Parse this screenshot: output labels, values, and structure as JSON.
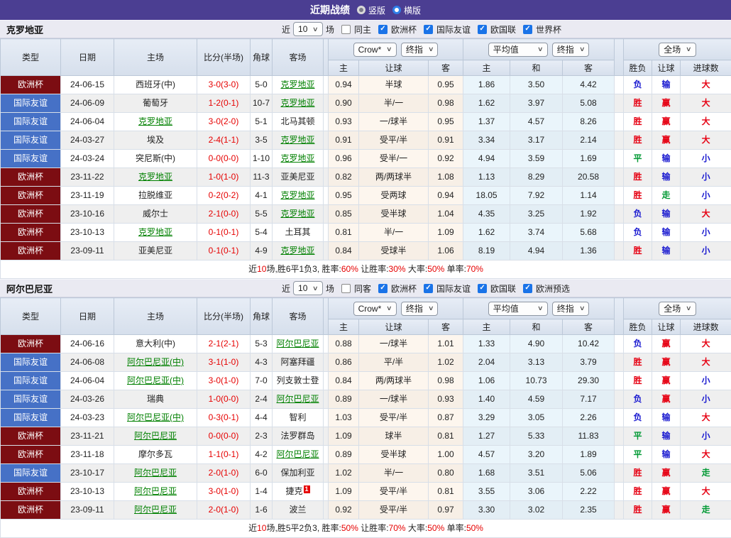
{
  "icons": {
    "check": "✓",
    "select_arrow": "∨"
  },
  "title_bar": {
    "title": "近期战绩",
    "radios": [
      {
        "label": "竖版",
        "selected": true
      },
      {
        "label": "横版",
        "selected": false
      }
    ]
  },
  "table_header": {
    "cols": [
      "类型",
      "日期",
      "主场",
      "比分(半场)",
      "角球",
      "客场"
    ],
    "odds_group": {
      "company": "Crow*",
      "stage": "终指",
      "sub": [
        "主",
        "让球",
        "客"
      ]
    },
    "avg_group": {
      "company": "平均值",
      "stage": "终指",
      "sub": [
        "主",
        "和",
        "客"
      ]
    },
    "result_group": {
      "scope": "全场",
      "sub": [
        "胜负",
        "让球",
        "进球数"
      ]
    }
  },
  "type_colors": {
    "欧洲杯": "t-maroon",
    "国际友谊": "t-blue"
  },
  "result_colors": {
    "胜": "r-red",
    "负": "r-blue",
    "平": "r-green",
    "赢": "r-red",
    "输": "r-blue",
    "走": "r-green",
    "大": "r-red",
    "小": "r-blue"
  },
  "sections": [
    {
      "team": "克罗地亚",
      "filter": {
        "near_label": "近",
        "count": "10",
        "games_label": "场",
        "same_label": "同主",
        "same_checked": false,
        "competitions": [
          "欧洲杯",
          "国际友谊",
          "欧国联",
          "世界杯"
        ]
      },
      "rows": [
        {
          "type": "欧洲杯",
          "date": "24-06-15",
          "home": "西班牙(中)",
          "home_link": false,
          "score": "3-0(3-0)",
          "corner": "5-0",
          "away": "克罗地亚",
          "away_link": true,
          "odds": [
            "0.94",
            "半球",
            "0.95"
          ],
          "avg": [
            "1.86",
            "3.50",
            "4.42"
          ],
          "res": [
            "负",
            "输",
            "大"
          ]
        },
        {
          "type": "国际友谊",
          "date": "24-06-09",
          "home": "葡萄牙",
          "home_link": false,
          "score": "1-2(0-1)",
          "corner": "10-7",
          "away": "克罗地亚",
          "away_link": true,
          "odds": [
            "0.90",
            "半/一",
            "0.98"
          ],
          "avg": [
            "1.62",
            "3.97",
            "5.08"
          ],
          "res": [
            "胜",
            "赢",
            "大"
          ]
        },
        {
          "type": "国际友谊",
          "date": "24-06-04",
          "home": "克罗地亚",
          "home_link": true,
          "score": "3-0(2-0)",
          "corner": "5-1",
          "away": "北马其顿",
          "away_link": false,
          "odds": [
            "0.93",
            "一/球半",
            "0.95"
          ],
          "avg": [
            "1.37",
            "4.57",
            "8.26"
          ],
          "res": [
            "胜",
            "赢",
            "大"
          ]
        },
        {
          "type": "国际友谊",
          "date": "24-03-27",
          "home": "埃及",
          "home_link": false,
          "score": "2-4(1-1)",
          "corner": "3-5",
          "away": "克罗地亚",
          "away_link": true,
          "odds": [
            "0.91",
            "受平/半",
            "0.91"
          ],
          "avg": [
            "3.34",
            "3.17",
            "2.14"
          ],
          "res": [
            "胜",
            "赢",
            "大"
          ]
        },
        {
          "type": "国际友谊",
          "date": "24-03-24",
          "home": "突尼斯(中)",
          "home_link": false,
          "score": "0-0(0-0)",
          "corner": "1-10",
          "away": "克罗地亚",
          "away_link": true,
          "odds": [
            "0.96",
            "受半/一",
            "0.92"
          ],
          "avg": [
            "4.94",
            "3.59",
            "1.69"
          ],
          "res": [
            "平",
            "输",
            "小"
          ]
        },
        {
          "type": "欧洲杯",
          "date": "23-11-22",
          "home": "克罗地亚",
          "home_link": true,
          "score": "1-0(1-0)",
          "corner": "11-3",
          "away": "亚美尼亚",
          "away_link": false,
          "odds": [
            "0.82",
            "两/两球半",
            "1.08"
          ],
          "avg": [
            "1.13",
            "8.29",
            "20.58"
          ],
          "res": [
            "胜",
            "输",
            "小"
          ]
        },
        {
          "type": "欧洲杯",
          "date": "23-11-19",
          "home": "拉脱维亚",
          "home_link": false,
          "score": "0-2(0-2)",
          "corner": "4-1",
          "away": "克罗地亚",
          "away_link": true,
          "odds": [
            "0.95",
            "受两球",
            "0.94"
          ],
          "avg": [
            "18.05",
            "7.92",
            "1.14"
          ],
          "res": [
            "胜",
            "走",
            "小"
          ]
        },
        {
          "type": "欧洲杯",
          "date": "23-10-16",
          "home": "威尔士",
          "home_link": false,
          "score": "2-1(0-0)",
          "corner": "5-5",
          "away": "克罗地亚",
          "away_link": true,
          "odds": [
            "0.85",
            "受半球",
            "1.04"
          ],
          "avg": [
            "4.35",
            "3.25",
            "1.92"
          ],
          "res": [
            "负",
            "输",
            "大"
          ]
        },
        {
          "type": "欧洲杯",
          "date": "23-10-13",
          "home": "克罗地亚",
          "home_link": true,
          "score": "0-1(0-1)",
          "corner": "5-4",
          "away": "土耳其",
          "away_link": false,
          "odds": [
            "0.81",
            "半/一",
            "1.09"
          ],
          "avg": [
            "1.62",
            "3.74",
            "5.68"
          ],
          "res": [
            "负",
            "输",
            "小"
          ]
        },
        {
          "type": "欧洲杯",
          "date": "23-09-11",
          "home": "亚美尼亚",
          "home_link": false,
          "score": "0-1(0-1)",
          "corner": "4-9",
          "away": "克罗地亚",
          "away_link": true,
          "odds": [
            "0.84",
            "受球半",
            "1.06"
          ],
          "avg": [
            "8.19",
            "4.94",
            "1.36"
          ],
          "res": [
            "胜",
            "输",
            "小"
          ]
        }
      ],
      "summary": [
        {
          "text": "近"
        },
        {
          "text": "10",
          "red": true
        },
        {
          "text": "场,胜6平1负3, 胜率:"
        },
        {
          "text": "60%",
          "red": true
        },
        {
          "text": " 让胜率:"
        },
        {
          "text": "30%",
          "red": true
        },
        {
          "text": " 大率:"
        },
        {
          "text": "50%",
          "red": true
        },
        {
          "text": " 单率:"
        },
        {
          "text": "70%",
          "red": true
        }
      ]
    },
    {
      "team": "阿尔巴尼亚",
      "filter": {
        "near_label": "近",
        "count": "10",
        "games_label": "场",
        "same_label": "同客",
        "same_checked": false,
        "competitions": [
          "欧洲杯",
          "国际友谊",
          "欧国联",
          "欧洲预选"
        ]
      },
      "rows": [
        {
          "type": "欧洲杯",
          "date": "24-06-16",
          "home": "意大利(中)",
          "home_link": false,
          "score": "2-1(2-1)",
          "corner": "5-3",
          "away": "阿尔巴尼亚",
          "away_link": true,
          "odds": [
            "0.88",
            "一/球半",
            "1.01"
          ],
          "avg": [
            "1.33",
            "4.90",
            "10.42"
          ],
          "res": [
            "负",
            "赢",
            "大"
          ]
        },
        {
          "type": "国际友谊",
          "date": "24-06-08",
          "home": "阿尔巴尼亚(中)",
          "home_link": true,
          "score": "3-1(1-0)",
          "corner": "4-3",
          "away": "阿塞拜疆",
          "away_link": false,
          "odds": [
            "0.86",
            "平/半",
            "1.02"
          ],
          "avg": [
            "2.04",
            "3.13",
            "3.79"
          ],
          "res": [
            "胜",
            "赢",
            "大"
          ]
        },
        {
          "type": "国际友谊",
          "date": "24-06-04",
          "home": "阿尔巴尼亚(中)",
          "home_link": true,
          "score": "3-0(1-0)",
          "corner": "7-0",
          "away": "列支敦士登",
          "away_link": false,
          "odds": [
            "0.84",
            "两/两球半",
            "0.98"
          ],
          "avg": [
            "1.06",
            "10.73",
            "29.30"
          ],
          "res": [
            "胜",
            "赢",
            "小"
          ]
        },
        {
          "type": "国际友谊",
          "date": "24-03-26",
          "home": "瑞典",
          "home_link": false,
          "score": "1-0(0-0)",
          "corner": "2-4",
          "away": "阿尔巴尼亚",
          "away_link": true,
          "odds": [
            "0.89",
            "一/球半",
            "0.93"
          ],
          "avg": [
            "1.40",
            "4.59",
            "7.17"
          ],
          "res": [
            "负",
            "赢",
            "小"
          ]
        },
        {
          "type": "国际友谊",
          "date": "24-03-23",
          "home": "阿尔巴尼亚(中)",
          "home_link": true,
          "score": "0-3(0-1)",
          "corner": "4-4",
          "away": "智利",
          "away_link": false,
          "odds": [
            "1.03",
            "受平/半",
            "0.87"
          ],
          "avg": [
            "3.29",
            "3.05",
            "2.26"
          ],
          "res": [
            "负",
            "输",
            "大"
          ]
        },
        {
          "type": "欧洲杯",
          "date": "23-11-21",
          "home": "阿尔巴尼亚",
          "home_link": true,
          "score": "0-0(0-0)",
          "corner": "2-3",
          "away": "法罗群岛",
          "away_link": false,
          "odds": [
            "1.09",
            "球半",
            "0.81"
          ],
          "avg": [
            "1.27",
            "5.33",
            "11.83"
          ],
          "res": [
            "平",
            "输",
            "小"
          ]
        },
        {
          "type": "欧洲杯",
          "date": "23-11-18",
          "home": "摩尔多瓦",
          "home_link": false,
          "score": "1-1(0-1)",
          "corner": "4-2",
          "away": "阿尔巴尼亚",
          "away_link": true,
          "odds": [
            "0.89",
            "受半球",
            "1.00"
          ],
          "avg": [
            "4.57",
            "3.20",
            "1.89"
          ],
          "res": [
            "平",
            "输",
            "大"
          ]
        },
        {
          "type": "国际友谊",
          "date": "23-10-17",
          "home": "阿尔巴尼亚",
          "home_link": true,
          "score": "2-0(1-0)",
          "corner": "6-0",
          "away": "保加利亚",
          "away_link": false,
          "odds": [
            "1.02",
            "半/一",
            "0.80"
          ],
          "avg": [
            "1.68",
            "3.51",
            "5.06"
          ],
          "res": [
            "胜",
            "赢",
            "走"
          ]
        },
        {
          "type": "欧洲杯",
          "date": "23-10-13",
          "home": "阿尔巴尼亚",
          "home_link": true,
          "score": "3-0(1-0)",
          "corner": "1-4",
          "away": "捷克",
          "away_link": false,
          "away_sup": "1",
          "odds": [
            "1.09",
            "受平/半",
            "0.81"
          ],
          "avg": [
            "3.55",
            "3.06",
            "2.22"
          ],
          "res": [
            "胜",
            "赢",
            "大"
          ]
        },
        {
          "type": "欧洲杯",
          "date": "23-09-11",
          "home": "阿尔巴尼亚",
          "home_link": true,
          "score": "2-0(1-0)",
          "corner": "1-6",
          "away": "波兰",
          "away_link": false,
          "odds": [
            "0.92",
            "受平/半",
            "0.97"
          ],
          "avg": [
            "3.30",
            "3.02",
            "2.35"
          ],
          "res": [
            "胜",
            "赢",
            "走"
          ]
        }
      ],
      "summary": [
        {
          "text": "近"
        },
        {
          "text": "10",
          "red": true
        },
        {
          "text": "场,胜5平2负3, 胜率:"
        },
        {
          "text": "50%",
          "red": true
        },
        {
          "text": " 让胜率:"
        },
        {
          "text": "70%",
          "red": true
        },
        {
          "text": " 大率:"
        },
        {
          "text": "50%",
          "red": true
        },
        {
          "text": " 单率:"
        },
        {
          "text": "50%",
          "red": true
        }
      ]
    }
  ]
}
